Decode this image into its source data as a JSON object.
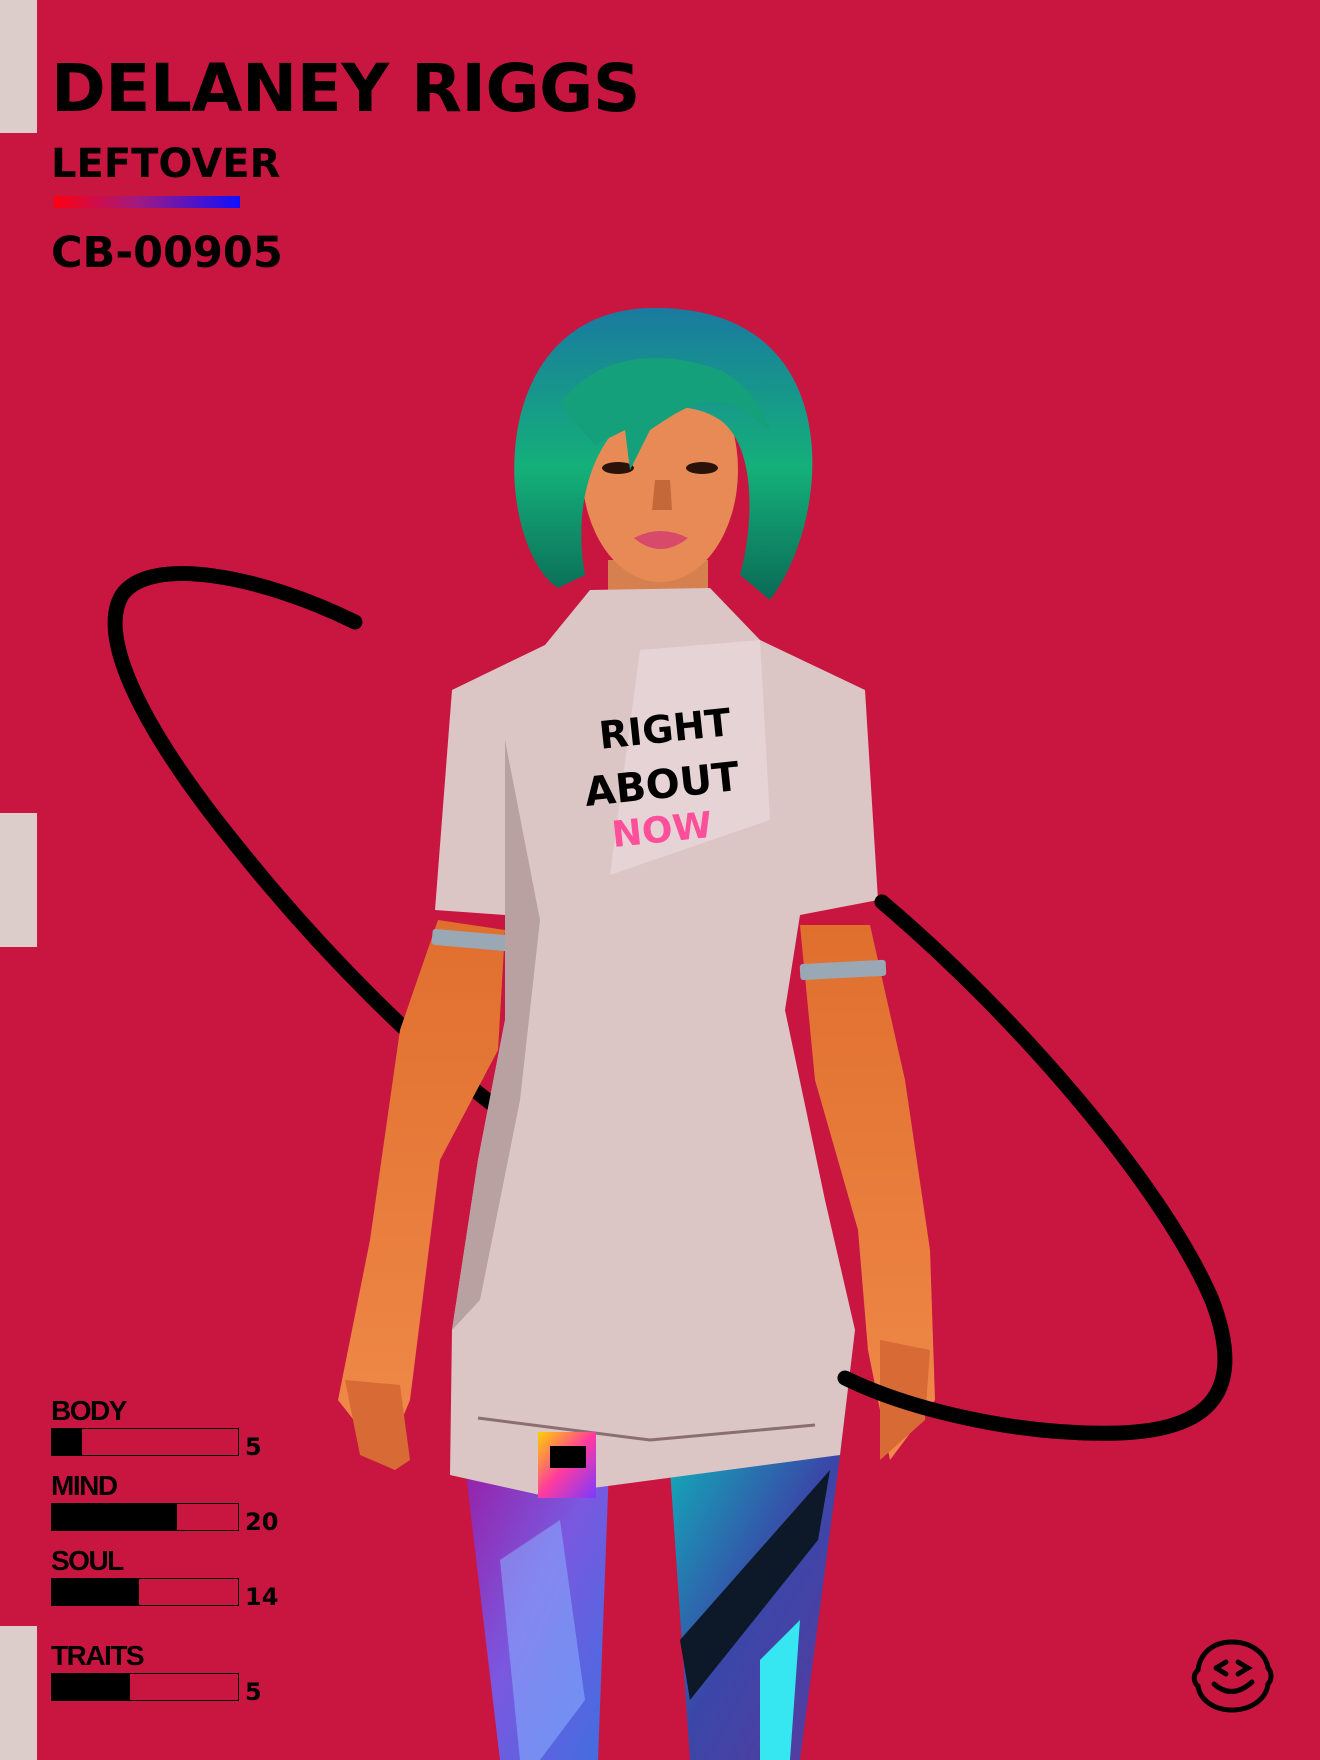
{
  "card": {
    "name": "DELANEY RIGGS",
    "class": "LEFTOVER",
    "id": "CB-00905"
  },
  "shirt": {
    "line1": "RIGHT",
    "line2": "ABOUT",
    "line3": "NOW"
  },
  "stats": [
    {
      "label": "BODY",
      "value": "5",
      "fill": 0.16
    },
    {
      "label": "MIND",
      "value": "20",
      "fill": 0.67
    },
    {
      "label": "SOUL",
      "value": "14",
      "fill": 0.47
    },
    {
      "label": "TRAITS",
      "value": "5",
      "fill": 0.42
    }
  ],
  "colors": {
    "background": "#c81641",
    "edge_tabs": "#dccdcb",
    "hair": "#12a67a",
    "shirt": "#d9c1c1",
    "accent_pink": "#ff4f9a"
  },
  "icons": {
    "logo": "smiley-face-logo-icon"
  }
}
